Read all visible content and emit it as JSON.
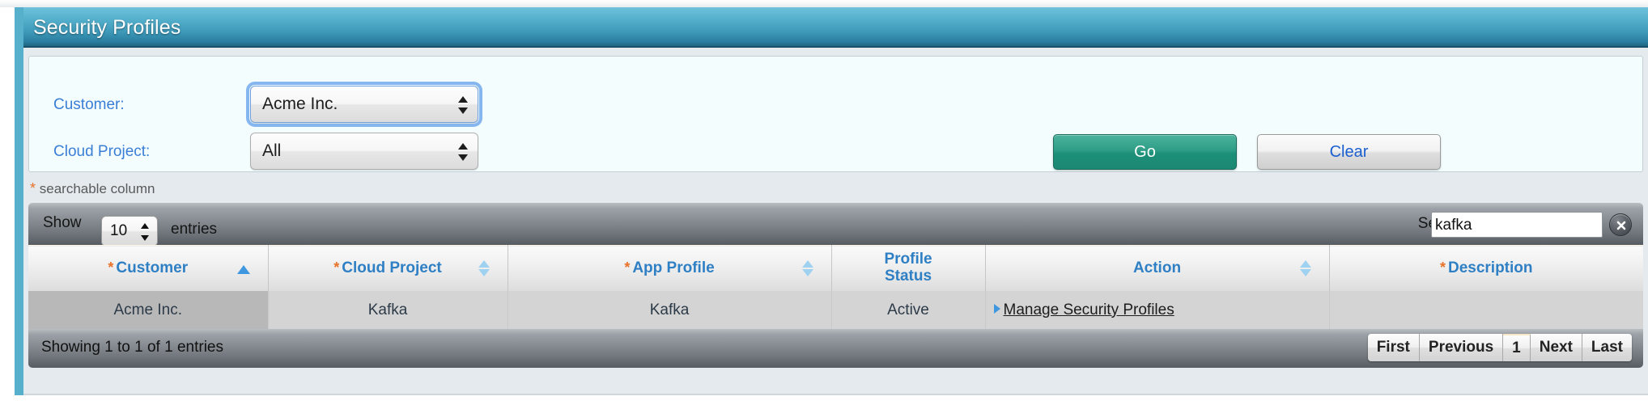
{
  "header": {
    "title": "Security Profiles"
  },
  "filter": {
    "customer_label": "Customer:",
    "customer_value": "Acme Inc.",
    "project_label": "Cloud Project:",
    "project_value": "All",
    "go_label": "Go",
    "clear_label": "Clear"
  },
  "note": {
    "asterisk": "*",
    "text": "searchable column"
  },
  "datatable": {
    "show_label": "Show",
    "length_value": "10",
    "entries_label": "entries",
    "search_label": "Search",
    "search_value": "kafka",
    "clear_icon": "clear-x-icon",
    "columns": [
      {
        "label": "Customer",
        "asterisk": "*",
        "sort": "asc"
      },
      {
        "label": "Cloud Project",
        "asterisk": "*",
        "sort": "both"
      },
      {
        "label": "App Profile",
        "asterisk": "*",
        "sort": "both"
      },
      {
        "label": "Profile Status",
        "asterisk": "",
        "sort": "none"
      },
      {
        "label": "Action",
        "asterisk": "",
        "sort": "both"
      },
      {
        "label": "Description",
        "asterisk": "*",
        "sort": "none"
      }
    ],
    "rows": [
      {
        "customer": "Acme Inc.",
        "cloud_project": "Kafka",
        "app_profile": "Kafka",
        "profile_status": "Active",
        "action": "Manage Security Profiles",
        "description": ""
      }
    ],
    "info": "Showing 1 to 1 of 1 entries",
    "paginate": [
      {
        "label": "First",
        "current": false
      },
      {
        "label": "Previous",
        "current": false
      },
      {
        "label": "1",
        "current": true
      },
      {
        "label": "Next",
        "current": false
      },
      {
        "label": "Last",
        "current": false
      }
    ]
  },
  "colors": {
    "header_gradient_top": "#6ec2da",
    "header_gradient_bottom": "#1d5d78",
    "rail": "#56b0cc",
    "go_button": "#1d9079",
    "link_blue": "#3a7fd5",
    "asterisk_orange": "#e8722a",
    "column_header_blue": "#2f7fc4"
  }
}
